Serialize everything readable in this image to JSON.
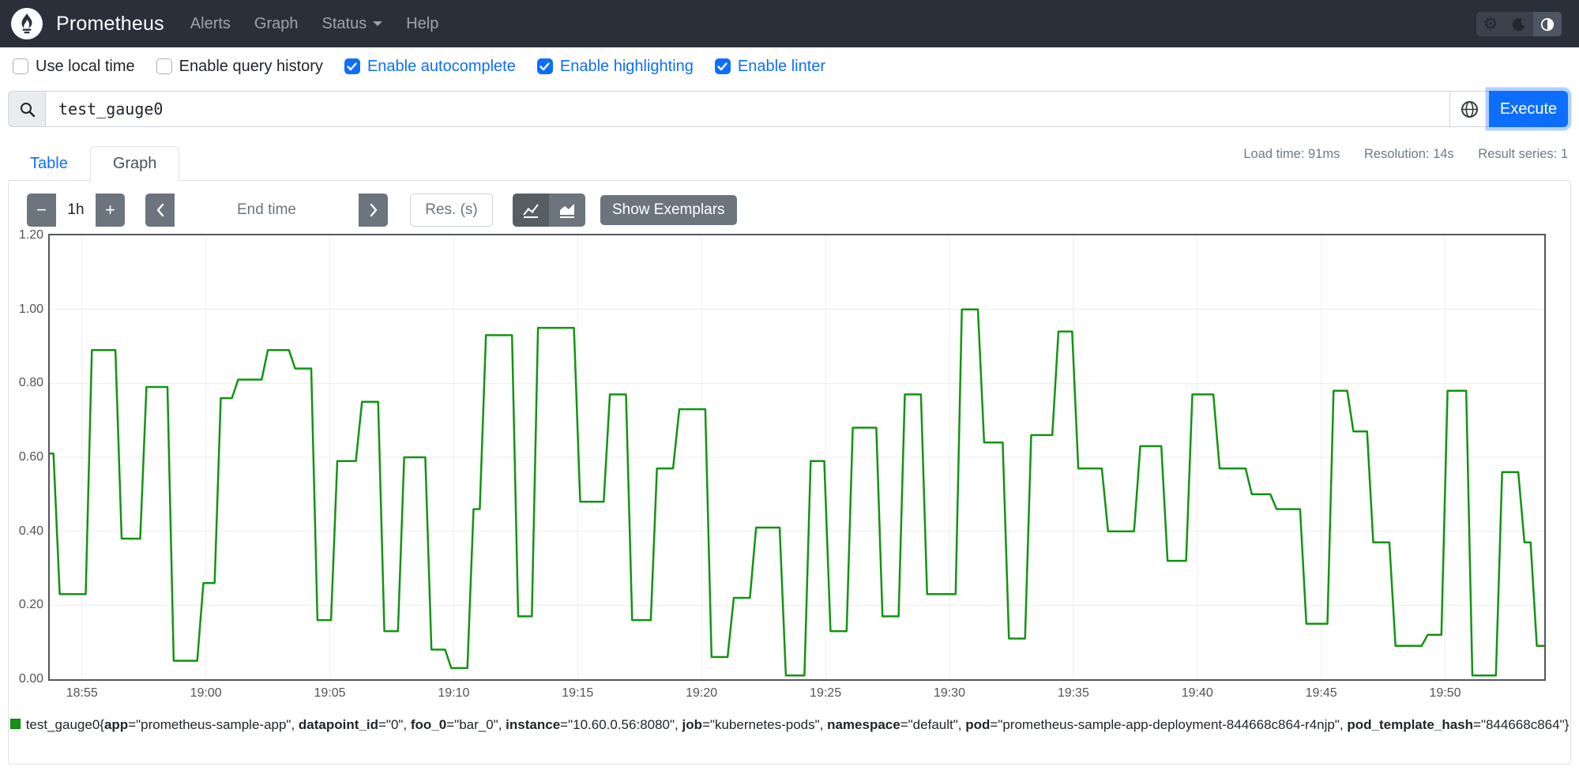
{
  "navbar": {
    "brand": "Prometheus",
    "links": [
      {
        "label": "Alerts",
        "caret": false
      },
      {
        "label": "Graph",
        "caret": false
      },
      {
        "label": "Status",
        "caret": true
      },
      {
        "label": "Help",
        "caret": false
      }
    ],
    "theme_buttons": [
      {
        "icon": "gear-icon",
        "active": false
      },
      {
        "icon": "moon-icon",
        "active": false
      },
      {
        "icon": "auto-theme-icon",
        "active": true
      }
    ]
  },
  "options_bar": {
    "checkboxes": [
      {
        "label": "Use local time",
        "checked": false
      },
      {
        "label": "Enable query history",
        "checked": false
      },
      {
        "label": "Enable autocomplete",
        "checked": true
      },
      {
        "label": "Enable highlighting",
        "checked": true
      },
      {
        "label": "Enable linter",
        "checked": true
      }
    ]
  },
  "query_bar": {
    "value": "test_gauge0",
    "execute_label": "Execute"
  },
  "stats": {
    "load_time": "Load time: 91ms",
    "resolution": "Resolution: 14s",
    "result_series": "Result series: 1"
  },
  "tabs": [
    {
      "label": "Table",
      "active": false
    },
    {
      "label": "Graph",
      "active": true
    }
  ],
  "graph_controls": {
    "minus_label": "−",
    "duration": "1h",
    "plus_label": "+",
    "end_time_placeholder": "End time",
    "res_placeholder": "Res. (s)",
    "show_exemplars_label": "Show Exemplars"
  },
  "chart_data": {
    "type": "line",
    "step": true,
    "title": "",
    "xlabel": "",
    "ylabel": "",
    "ylim": [
      0,
      1.2
    ],
    "y_tick_labels": [
      "1.20",
      "1.00",
      "0.80",
      "0.60",
      "0.40",
      "0.20",
      "0.00"
    ],
    "x_tick_labels": [
      "18:55",
      "19:00",
      "19:05",
      "19:10",
      "19:15",
      "19:20",
      "19:25",
      "19:30",
      "19:35",
      "19:40",
      "19:45",
      "19:50"
    ],
    "x_first_tick_offset_min": 1.3,
    "x_tick_interval_min": 5,
    "x_total_min": 60.3,
    "grid": true,
    "legend_position": "bottom-center",
    "series": [
      {
        "name": "test_gauge0",
        "color": "#129412",
        "points_min_value": [
          [
            0.0,
            0.61
          ],
          [
            0.4,
            0.23
          ],
          [
            1.7,
            0.89
          ],
          [
            2.9,
            0.38
          ],
          [
            3.9,
            0.79
          ],
          [
            5.0,
            0.05
          ],
          [
            6.2,
            0.26
          ],
          [
            6.9,
            0.76
          ],
          [
            7.6,
            0.81
          ],
          [
            8.8,
            0.89
          ],
          [
            9.9,
            0.84
          ],
          [
            10.8,
            0.16
          ],
          [
            11.6,
            0.59
          ],
          [
            12.6,
            0.75
          ],
          [
            13.5,
            0.13
          ],
          [
            14.3,
            0.6
          ],
          [
            15.4,
            0.08
          ],
          [
            16.2,
            0.03
          ],
          [
            17.1,
            0.46
          ],
          [
            17.6,
            0.93
          ],
          [
            18.9,
            0.17
          ],
          [
            19.7,
            0.95
          ],
          [
            21.4,
            0.48
          ],
          [
            22.6,
            0.77
          ],
          [
            23.5,
            0.16
          ],
          [
            24.5,
            0.57
          ],
          [
            25.4,
            0.73
          ],
          [
            26.7,
            0.06
          ],
          [
            27.6,
            0.22
          ],
          [
            28.5,
            0.41
          ],
          [
            29.7,
            0.01
          ],
          [
            30.7,
            0.59
          ],
          [
            31.5,
            0.13
          ],
          [
            32.4,
            0.68
          ],
          [
            33.6,
            0.17
          ],
          [
            34.5,
            0.77
          ],
          [
            35.4,
            0.23
          ],
          [
            36.8,
            1.0
          ],
          [
            37.7,
            0.64
          ],
          [
            38.7,
            0.11
          ],
          [
            39.6,
            0.66
          ],
          [
            40.7,
            0.94
          ],
          [
            41.5,
            0.57
          ],
          [
            42.7,
            0.4
          ],
          [
            44.0,
            0.63
          ],
          [
            45.1,
            0.32
          ],
          [
            46.1,
            0.77
          ],
          [
            47.2,
            0.57
          ],
          [
            48.5,
            0.5
          ],
          [
            49.5,
            0.46
          ],
          [
            50.7,
            0.15
          ],
          [
            51.8,
            0.78
          ],
          [
            52.6,
            0.67
          ],
          [
            53.4,
            0.37
          ],
          [
            54.3,
            0.09
          ],
          [
            55.6,
            0.12
          ],
          [
            56.4,
            0.78
          ],
          [
            57.4,
            0.01
          ],
          [
            58.6,
            0.56
          ],
          [
            59.5,
            0.37
          ],
          [
            60.0,
            0.09
          ]
        ]
      }
    ]
  },
  "legend": {
    "metric_name": "test_gauge0",
    "labels": [
      {
        "key": "app",
        "value": "prometheus-sample-app"
      },
      {
        "key": "datapoint_id",
        "value": "0"
      },
      {
        "key": "foo_0",
        "value": "bar_0"
      },
      {
        "key": "instance",
        "value": "10.60.0.56:8080"
      },
      {
        "key": "job",
        "value": "kubernetes-pods"
      },
      {
        "key": "namespace",
        "value": "default"
      },
      {
        "key": "pod",
        "value": "prometheus-sample-app-deployment-844668c864-r4njp"
      },
      {
        "key": "pod_template_hash",
        "value": "844668c864"
      }
    ]
  },
  "colors": {
    "navbar_bg": "#2a2f3a",
    "accent_blue": "#0d6efd",
    "secondary_gray": "#6c757d",
    "secondary_gray_active": "#565e64",
    "series_green": "#129412",
    "chart_border": "#54575c",
    "gridline": "#ededed",
    "tick_text": "#545454",
    "stats_text": "#6c7a89"
  }
}
